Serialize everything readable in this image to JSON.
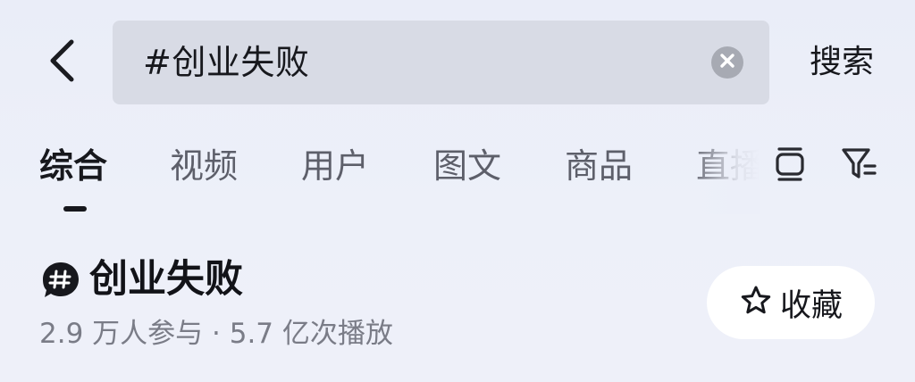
{
  "search": {
    "value": "#创业失败",
    "submit_label": "搜索"
  },
  "tabs": [
    {
      "label": "综合",
      "active": true
    },
    {
      "label": "视频",
      "active": false
    },
    {
      "label": "用户",
      "active": false
    },
    {
      "label": "图文",
      "active": false
    },
    {
      "label": "商品",
      "active": false
    },
    {
      "label": "直播",
      "active": false
    }
  ],
  "toolbar": {
    "layout_icon": "layout-toggle-icon",
    "filter_icon": "filter-icon"
  },
  "topic": {
    "badge_icon": "hashtag-icon",
    "title": "创业失败",
    "stats": "2.9 万人参与 · 5.7 亿次播放",
    "collect_label": "收藏",
    "collect_icon": "star-outline-icon"
  },
  "colors": {
    "background": "#eceff9",
    "search_box": "#d8dbe5",
    "text_primary": "#17181d",
    "text_secondary": "#7a7c87",
    "tab_inactive": "#5d5f6a"
  }
}
